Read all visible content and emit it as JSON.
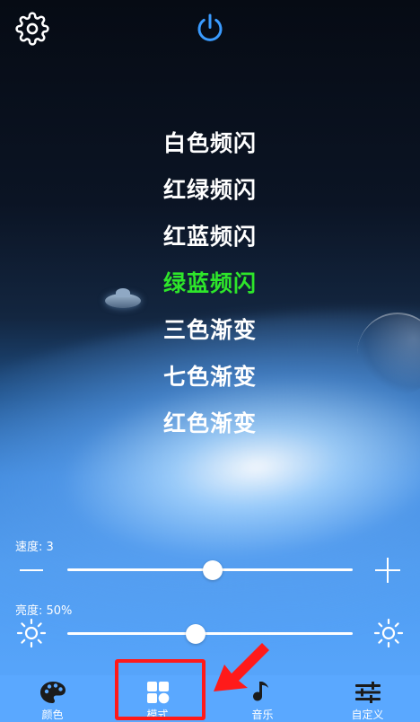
{
  "modes": {
    "items": [
      "白色频闪",
      "红绿频闪",
      "红蓝频闪",
      "绿蓝频闪",
      "三色渐变",
      "七色渐变",
      "红色渐变"
    ],
    "active_index": 3
  },
  "speed": {
    "label": "速度: 3",
    "value": 3,
    "fraction": 0.51
  },
  "brightness": {
    "label": "亮度: 50%",
    "value": 50,
    "fraction": 0.45
  },
  "tabs": [
    {
      "label": "颜色",
      "icon": "palette-icon"
    },
    {
      "label": "模式",
      "icon": "grid-mode-icon"
    },
    {
      "label": "音乐",
      "icon": "music-note-icon"
    },
    {
      "label": "自定义",
      "icon": "sliders-icon"
    }
  ],
  "selected_tab": 1,
  "colors": {
    "active_mode": "#2ee62a",
    "power_icon": "#3a9bff",
    "annotation": "#ff1a1a",
    "bottom_bar": "#5aa8ff"
  }
}
